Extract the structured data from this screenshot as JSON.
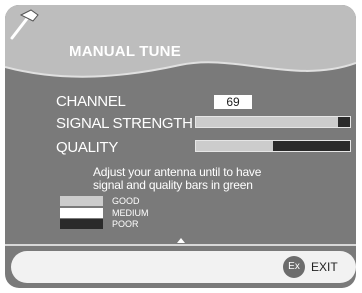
{
  "header": {
    "title": "MANUAL TUNE",
    "icon": "wrench-icon"
  },
  "channel": {
    "label": "CHANNEL",
    "value": "69"
  },
  "signal": {
    "label": "SIGNAL STRENGTH",
    "level": 0.92
  },
  "quality": {
    "label": "QUALITY",
    "level": 0.5
  },
  "instructions": {
    "line1": "Adjust your antenna until to have",
    "line2": "signal and quality bars in green"
  },
  "legend": [
    {
      "label": "GOOD",
      "color": "#cccccc"
    },
    {
      "label": "MEDIUM",
      "color": "#ffffff"
    },
    {
      "label": "POOR",
      "color": "#2a2a2a"
    }
  ],
  "footer": {
    "exit_key": "Ex",
    "exit_label": "EXIT"
  },
  "colors": {
    "panel": "#7a7a7a",
    "header": "#bdbdbd",
    "footer": "#f2f2f2"
  }
}
